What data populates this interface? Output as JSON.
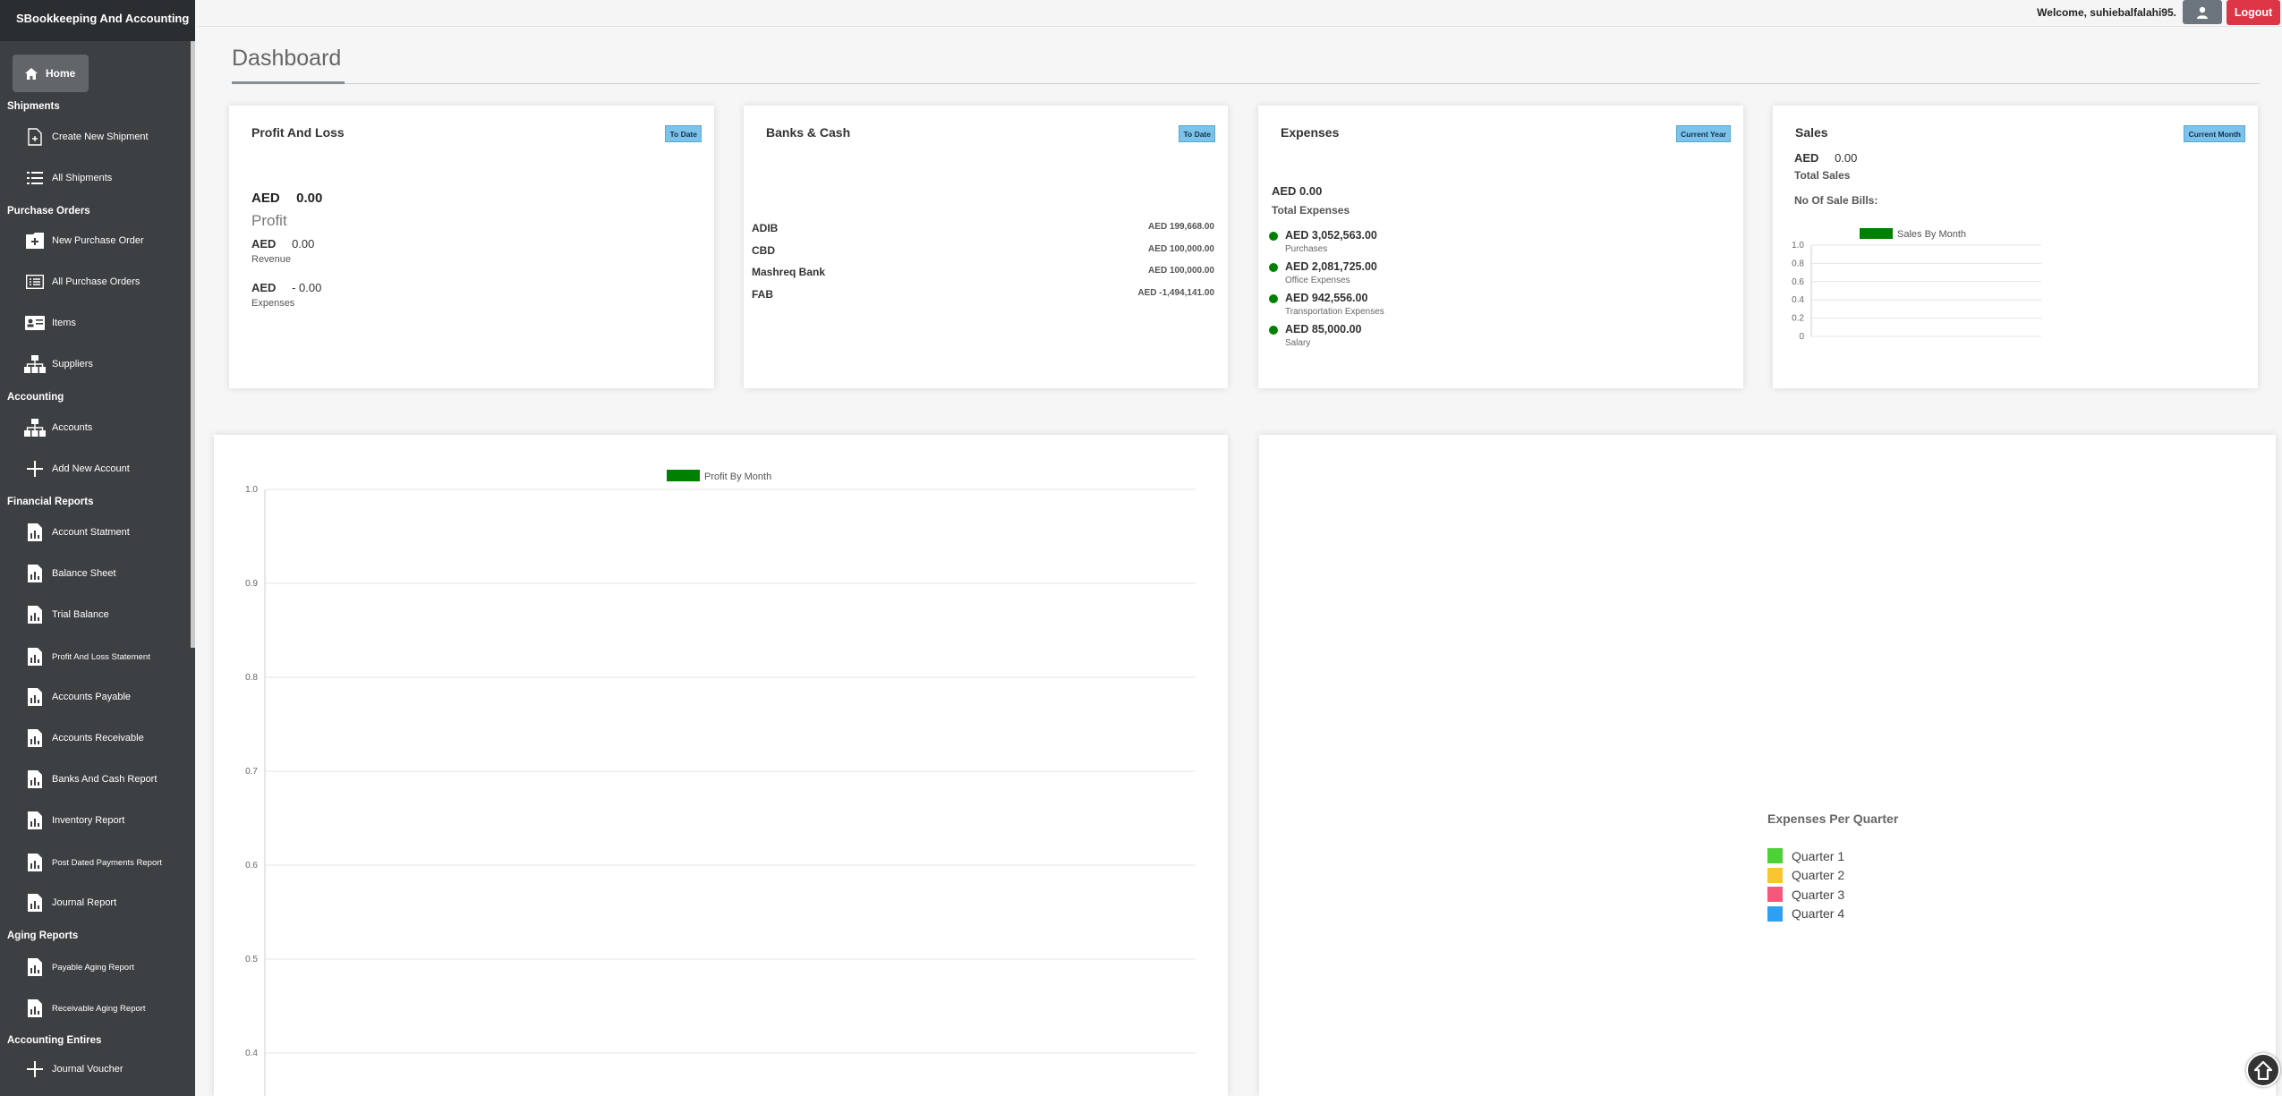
{
  "app": {
    "title": "SBookkeeping And Accounting"
  },
  "topbar": {
    "welcome": "Welcome, suhiebalfalahi95.",
    "logout_label": "Logout"
  },
  "sidebar": {
    "home_label": "Home",
    "sections": {
      "shipments": "Shipments",
      "purchase_orders": "Purchase Orders",
      "accounting": "Accounting",
      "financial_reports": "Financial Reports",
      "aging_reports": "Aging Reports",
      "accounting_entries": "Accounting Entires"
    },
    "items": {
      "create_shipment": "Create New Shipment",
      "all_shipments": "All Shipments",
      "new_po": "New Purchase Order",
      "all_po": "All Purchase Orders",
      "items": "Items",
      "suppliers": "Suppliers",
      "accounts": "Accounts",
      "add_account": "Add New Account",
      "account_statment": "Account Statment",
      "balance_sheet": "Balance Sheet",
      "trial_balance": "Trial Balance",
      "pl_statement": "Profit And Loss Statement",
      "accounts_payable": "Accounts Payable",
      "accounts_receivable": "Accounts Receivable",
      "banks_cash_report": "Banks And Cash Report",
      "inventory_report": "Inventory Report",
      "pdc_report": "Post Dated Payments Report",
      "journal_report": "Journal Report",
      "payable_aging": "Payable Aging Report",
      "receivable_aging": "Receivable Aging Report",
      "journal_voucher": "Journal Voucher"
    }
  },
  "page": {
    "title": "Dashboard"
  },
  "cards": {
    "pl": {
      "title": "Profit And Loss",
      "badge": "To Date",
      "currency": "AED",
      "profit_value": "0.00",
      "profit_label": "Profit",
      "revenue_value": "0.00",
      "revenue_label": "Revenue",
      "expenses_value": "- 0.00",
      "expenses_label": "Expenses"
    },
    "banks": {
      "title": "Banks & Cash",
      "badge": "To Date",
      "rows": [
        {
          "name": "ADIB",
          "amount": "AED 199,668.00"
        },
        {
          "name": "CBD",
          "amount": "AED 100,000.00"
        },
        {
          "name": "Mashreq Bank",
          "amount": "AED 100,000.00"
        },
        {
          "name": "FAB",
          "amount": "AED -1,494,141.00"
        }
      ]
    },
    "expenses": {
      "title": "Expenses",
      "badge": "Current Year",
      "total": "AED 0.00",
      "total_label": "Total Expenses",
      "rows": [
        {
          "amount": "AED 3,052,563.00",
          "label": "Purchases"
        },
        {
          "amount": "AED 2,081,725.00",
          "label": "Office Expenses"
        },
        {
          "amount": "AED 942,556.00",
          "label": "Transportation Expenses"
        },
        {
          "amount": "AED 85,000.00",
          "label": "Salary"
        }
      ]
    },
    "sales": {
      "title": "Sales",
      "badge": "Current Month",
      "currency": "AED",
      "value": "0.00",
      "total_label": "Total Sales",
      "bills_label": "No Of Sale Bills:"
    }
  },
  "chart_data": [
    {
      "type": "bar",
      "legend": "Sales By Month",
      "color": "#008000",
      "categories": [],
      "values": [],
      "ylim": [
        0,
        1
      ],
      "yticks": [
        "1.0",
        "0.8",
        "0.6",
        "0.4",
        "0.2",
        "0"
      ]
    },
    {
      "type": "bar",
      "legend": "Profit By Month",
      "color": "#008000",
      "categories": [],
      "values": [],
      "yticks": [
        "1.0",
        "0.9",
        "0.8",
        "0.7",
        "0.6",
        "0.5",
        "0.4"
      ]
    },
    {
      "type": "pie",
      "title": "Expenses Per Quarter",
      "labels": [
        "Quarter 1",
        "Quarter 2",
        "Quarter 3",
        "Quarter 4"
      ],
      "colors": [
        "#4cd137",
        "#fbc531",
        "#f5587b",
        "#2e9ff5"
      ],
      "values": []
    }
  ]
}
